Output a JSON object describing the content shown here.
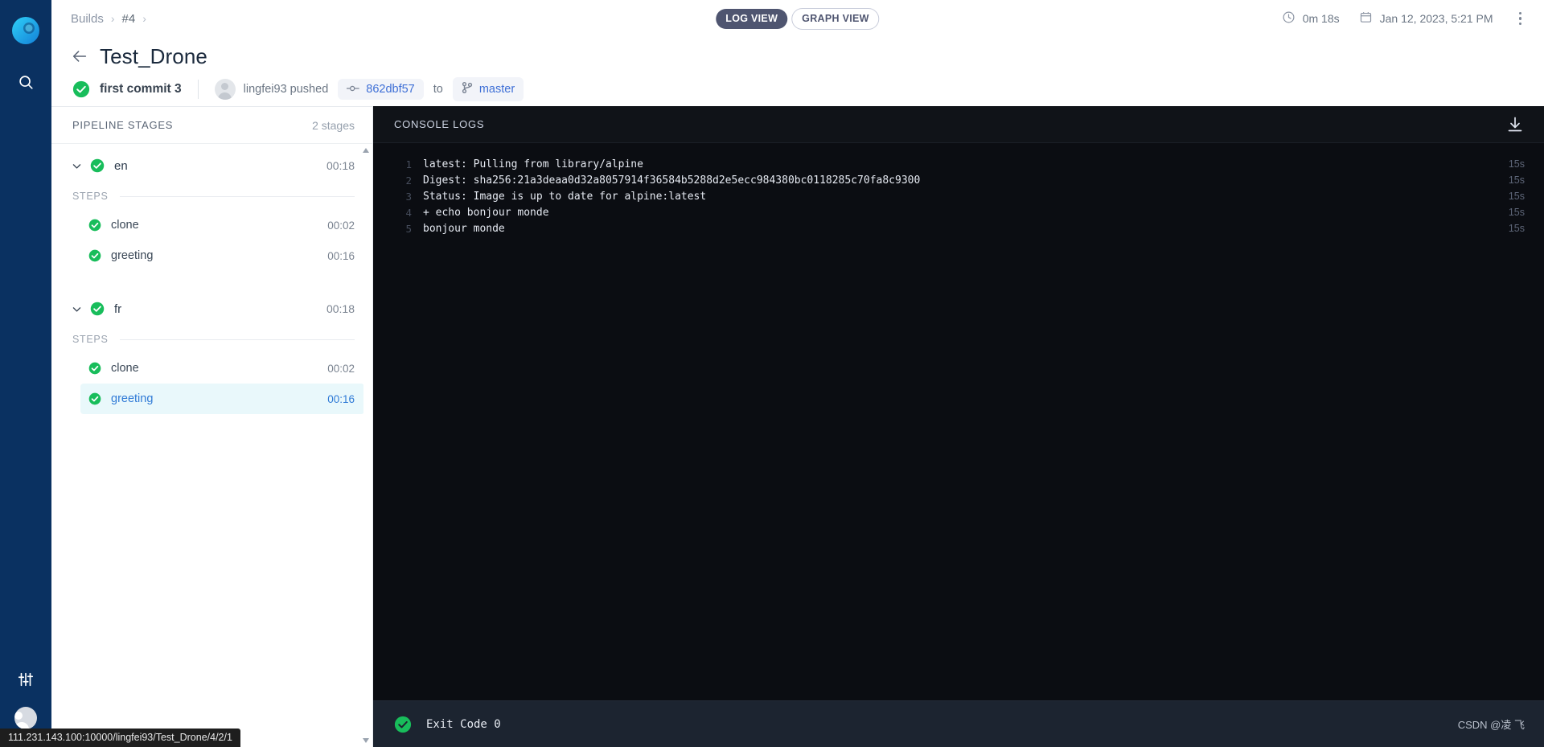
{
  "rail": {
    "logo_icon": "drone-logo-icon",
    "search_icon": "search-icon",
    "settings_icon": "sliders-icon",
    "avatar_icon": "user-avatar-icon"
  },
  "topbar": {
    "breadcrumb": [
      "Builds",
      "#4"
    ],
    "view_toggle": {
      "active": "LOG VIEW",
      "inactive": "GRAPH VIEW"
    },
    "duration": "0m 18s",
    "duration_icon": "clock-icon",
    "date": "Jan 12, 2023, 5:21 PM",
    "date_icon": "calendar-icon",
    "kebab_icon": "more-vertical-icon"
  },
  "header": {
    "back_icon": "arrow-left-icon",
    "title": "Test_Drone",
    "status_icon": "check-circle-icon",
    "commit_message": "first commit 3",
    "author": "lingfei93 pushed",
    "commit_sha": "862dbf57",
    "commit_icon": "commit-node-icon",
    "to_label": "to",
    "branch": "master",
    "branch_icon": "branch-icon"
  },
  "stages_panel": {
    "title": "PIPELINE STAGES",
    "count": "2 stages",
    "steps_label": "STEPS",
    "stages": [
      {
        "name": "en",
        "time": "00:18",
        "status_icon": "check-circle-icon",
        "chevron_icon": "chevron-down-icon",
        "steps": [
          {
            "name": "clone",
            "time": "00:02",
            "status_icon": "check-circle-icon",
            "selected": false
          },
          {
            "name": "greeting",
            "time": "00:16",
            "status_icon": "check-circle-icon",
            "selected": false
          }
        ]
      },
      {
        "name": "fr",
        "time": "00:18",
        "status_icon": "check-circle-icon",
        "chevron_icon": "chevron-down-icon",
        "steps": [
          {
            "name": "clone",
            "time": "00:02",
            "status_icon": "check-circle-icon",
            "selected": false
          },
          {
            "name": "greeting",
            "time": "00:16",
            "status_icon": "check-circle-icon",
            "selected": true
          }
        ]
      }
    ]
  },
  "console": {
    "title": "CONSOLE LOGS",
    "download_icon": "download-icon",
    "lines": [
      {
        "n": "1",
        "text": "latest: Pulling from library/alpine",
        "elapsed": "15s"
      },
      {
        "n": "2",
        "text": "Digest: sha256:21a3deaa0d32a8057914f36584b5288d2e5ecc984380bc0118285c70fa8c9300",
        "elapsed": "15s"
      },
      {
        "n": "3",
        "text": "Status: Image is up to date for alpine:latest",
        "elapsed": "15s"
      },
      {
        "n": "4",
        "text": "+ echo bonjour monde",
        "elapsed": "15s"
      },
      {
        "n": "5",
        "text": "bonjour monde",
        "elapsed": "15s"
      }
    ],
    "exit_icon": "check-circle-icon",
    "exit_text": "Exit Code 0",
    "watermark": "CSDN @凌 飞"
  },
  "status_bar": {
    "url": "111.231.143.100:10000/lingfei93/Test_Drone/4/2/1"
  },
  "colors": {
    "rail_bg": "#0a3161",
    "success_green": "#18bd5b",
    "link_blue": "#3e6fd6",
    "selected_step_bg": "#e9f8fb",
    "console_bg": "#0b0d12",
    "console_footer_bg": "#1c2430",
    "toggle_active_bg": "#4f5570"
  }
}
